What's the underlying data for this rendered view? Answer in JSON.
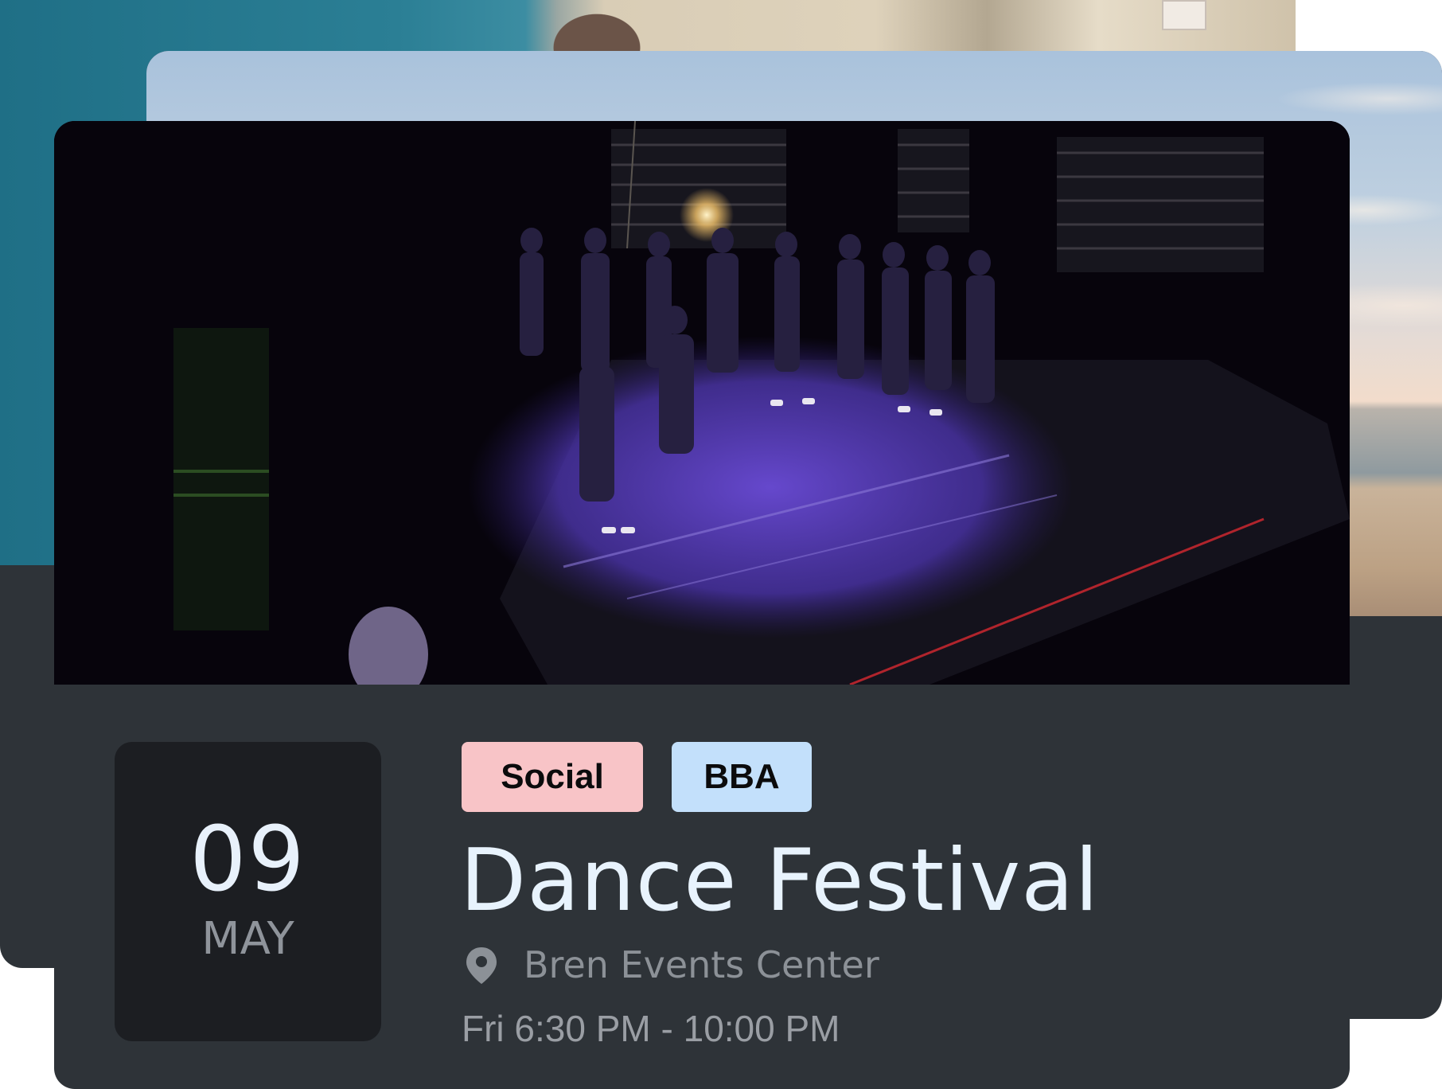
{
  "event": {
    "date_day": "09",
    "date_month": "MAY",
    "tags": [
      {
        "label": "Social",
        "color": "#f8c4c7"
      },
      {
        "label": "BBA",
        "color": "#c3e0fb"
      }
    ],
    "title": "Dance Festival",
    "location": "Bren Events Center",
    "location_icon": "map-pin-icon",
    "time": "Fri 6:30 PM - 10:00 PM"
  },
  "colors": {
    "card_background": "#2e3338",
    "date_box_background": "#1c1e22",
    "title_text": "#e8f3fd",
    "secondary_text": "#8c9197"
  }
}
